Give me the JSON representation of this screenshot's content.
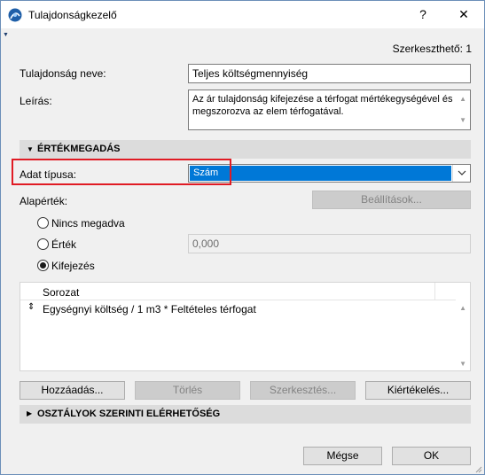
{
  "window": {
    "title": "Tulajdonságkezelő",
    "help": "?",
    "close": "✕"
  },
  "editable": "Szerkeszthető: 1",
  "property_name": {
    "label": "Tulajdonság neve:",
    "value": "Teljes költségmennyiség"
  },
  "description": {
    "label": "Leírás:",
    "value": "Az ár tulajdonság kifejezése a térfogat mértékegységével és megszorozva az elem térfogatával."
  },
  "section_value": {
    "title": "ÉRTÉKMEGADÁS"
  },
  "data_type": {
    "label": "Adat típusa:",
    "selected": "Szám"
  },
  "default_value": {
    "label": "Alapérték:",
    "settings_button": "Beállítások...",
    "options": [
      {
        "label": "Nincs megadva",
        "checked": false
      },
      {
        "label": "Érték",
        "checked": false,
        "value": "0,000"
      },
      {
        "label": "Kifejezés",
        "checked": true
      }
    ]
  },
  "table": {
    "header": "Sorozat",
    "rows": [
      "Egységnyi költség / 1 m3 * Feltételes térfogat"
    ]
  },
  "buttons": {
    "add": "Hozzáadás...",
    "delete": "Törlés",
    "edit": "Szerkesztés...",
    "evaluate": "Kiértékelés...",
    "cancel": "Mégse",
    "ok": "OK"
  },
  "section_classes": {
    "title": "OSZTÁLYOK SZERINTI ELÉRHETŐSÉG"
  },
  "colors": {
    "accent": "#0078d7",
    "highlight": "#e01b24"
  }
}
